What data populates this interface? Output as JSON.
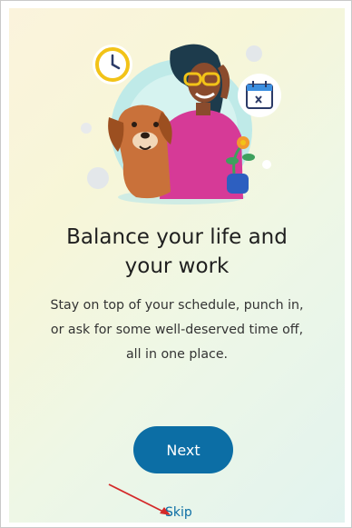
{
  "onboarding": {
    "headline": "Balance your life and\nyour work",
    "body": "Stay on top of your schedule, punch in,\nor ask for some well-deserved time off,\nall in one place.",
    "next_label": "Next",
    "skip_label": "Skip"
  },
  "illustration": {
    "icons": [
      "clock-icon",
      "calendar-icon",
      "dog-illustration",
      "person-illustration",
      "flower-pot-illustration"
    ]
  },
  "colors": {
    "primary": "#0c6ea5",
    "annotation_arrow": "#d42a2a",
    "headline_text": "#1f1f1f",
    "body_text": "#333333"
  }
}
